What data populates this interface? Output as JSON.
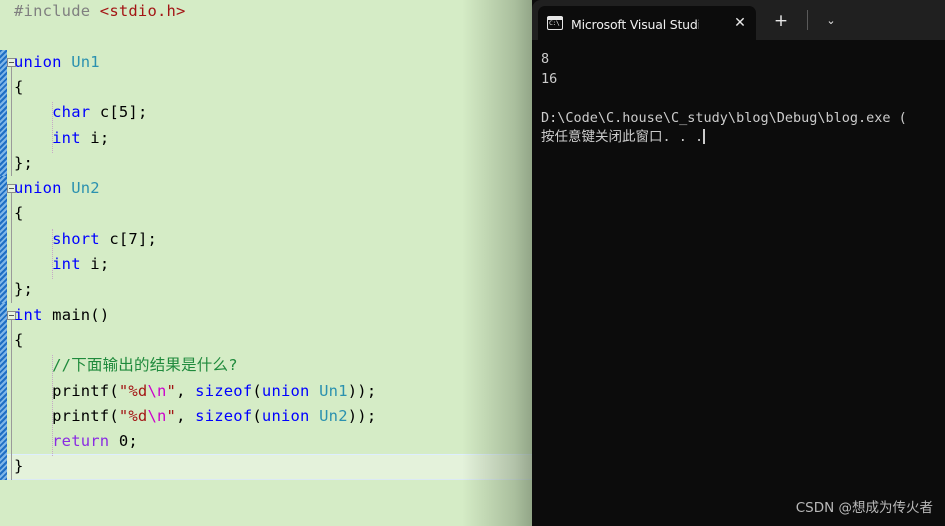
{
  "editor": {
    "app": "Microsoft Visual Studio",
    "theme_background": "#d5ecc6",
    "lines": [
      {
        "indent": 0,
        "tokens": [
          {
            "text": "#include ",
            "cls": "t-pre"
          },
          {
            "text": "<stdio.h>",
            "cls": "t-inc"
          }
        ]
      },
      {
        "indent": 0,
        "tokens": []
      },
      {
        "indent": 0,
        "tokens": [
          {
            "text": "union ",
            "cls": "t-kw"
          },
          {
            "text": "Un1",
            "cls": "t-type"
          }
        ]
      },
      {
        "indent": 0,
        "tokens": [
          {
            "text": "{",
            "cls": "t-plain"
          }
        ]
      },
      {
        "indent": 0,
        "tokens": [
          {
            "text": "    ",
            "cls": "t-plain"
          },
          {
            "text": "char",
            "cls": "t-kw"
          },
          {
            "text": " c[5];",
            "cls": "t-plain"
          }
        ]
      },
      {
        "indent": 0,
        "tokens": [
          {
            "text": "    ",
            "cls": "t-plain"
          },
          {
            "text": "int",
            "cls": "t-kw"
          },
          {
            "text": " i;",
            "cls": "t-plain"
          }
        ]
      },
      {
        "indent": 0,
        "tokens": [
          {
            "text": "};",
            "cls": "t-plain"
          }
        ]
      },
      {
        "indent": 0,
        "tokens": [
          {
            "text": "union ",
            "cls": "t-kw"
          },
          {
            "text": "Un2",
            "cls": "t-type"
          }
        ]
      },
      {
        "indent": 0,
        "tokens": [
          {
            "text": "{",
            "cls": "t-plain"
          }
        ]
      },
      {
        "indent": 0,
        "tokens": [
          {
            "text": "    ",
            "cls": "t-plain"
          },
          {
            "text": "short",
            "cls": "t-kw"
          },
          {
            "text": " c[7];",
            "cls": "t-plain"
          }
        ]
      },
      {
        "indent": 0,
        "tokens": [
          {
            "text": "    ",
            "cls": "t-plain"
          },
          {
            "text": "int",
            "cls": "t-kw"
          },
          {
            "text": " i;",
            "cls": "t-plain"
          }
        ]
      },
      {
        "indent": 0,
        "tokens": [
          {
            "text": "};",
            "cls": "t-plain"
          }
        ]
      },
      {
        "indent": 0,
        "tokens": [
          {
            "text": "int",
            "cls": "t-kw"
          },
          {
            "text": " ",
            "cls": "t-plain"
          },
          {
            "text": "main",
            "cls": "t-func"
          },
          {
            "text": "()",
            "cls": "t-plain"
          }
        ]
      },
      {
        "indent": 0,
        "tokens": [
          {
            "text": "{",
            "cls": "t-plain"
          }
        ]
      },
      {
        "indent": 0,
        "tokens": [
          {
            "text": "    ",
            "cls": "t-plain"
          },
          {
            "text": "//下面输出的结果是什么?",
            "cls": "t-cmt"
          }
        ]
      },
      {
        "indent": 0,
        "tokens": [
          {
            "text": "    printf(",
            "cls": "t-plain"
          },
          {
            "text": "\"%d",
            "cls": "t-str"
          },
          {
            "text": "\\n",
            "cls": "t-esc"
          },
          {
            "text": "\"",
            "cls": "t-str"
          },
          {
            "text": ", ",
            "cls": "t-plain"
          },
          {
            "text": "sizeof",
            "cls": "t-kw"
          },
          {
            "text": "(",
            "cls": "t-plain"
          },
          {
            "text": "union",
            "cls": "t-kw"
          },
          {
            "text": " ",
            "cls": "t-plain"
          },
          {
            "text": "Un1",
            "cls": "t-type"
          },
          {
            "text": "));",
            "cls": "t-plain"
          }
        ]
      },
      {
        "indent": 0,
        "tokens": [
          {
            "text": "    printf(",
            "cls": "t-plain"
          },
          {
            "text": "\"%d",
            "cls": "t-str"
          },
          {
            "text": "\\n",
            "cls": "t-esc"
          },
          {
            "text": "\"",
            "cls": "t-str"
          },
          {
            "text": ", ",
            "cls": "t-plain"
          },
          {
            "text": "sizeof",
            "cls": "t-kw"
          },
          {
            "text": "(",
            "cls": "t-plain"
          },
          {
            "text": "union",
            "cls": "t-kw"
          },
          {
            "text": " ",
            "cls": "t-plain"
          },
          {
            "text": "Un2",
            "cls": "t-type"
          },
          {
            "text": "));",
            "cls": "t-plain"
          }
        ]
      },
      {
        "indent": 0,
        "tokens": [
          {
            "text": "    ",
            "cls": "t-plain"
          },
          {
            "text": "return",
            "cls": "t-ret"
          },
          {
            "text": " 0;",
            "cls": "t-plain"
          }
        ]
      },
      {
        "indent": 0,
        "tokens": [
          {
            "text": "}",
            "cls": "t-plain"
          }
        ]
      }
    ],
    "collapse_boxes": [
      {
        "line": 2
      },
      {
        "line": 7
      },
      {
        "line": 12
      }
    ],
    "current_line_index": 18
  },
  "terminal": {
    "tab": {
      "title": "Microsoft Visual Studio 调试控制台",
      "icon": "console-icon",
      "close_label": "✕"
    },
    "newtab_label": "+",
    "dropdown_label": "⌄",
    "output_lines": [
      "8",
      "16",
      "",
      "D:\\Code\\C.house\\C_study\\blog\\Debug\\blog.exe (",
      "按任意键关闭此窗口. . ."
    ],
    "cursor_after_line": 4,
    "watermark": "CSDN @想成为传火者",
    "colors": {
      "background": "#0c0c0c",
      "titlebar": "#202020",
      "text": "#cccccc"
    }
  }
}
